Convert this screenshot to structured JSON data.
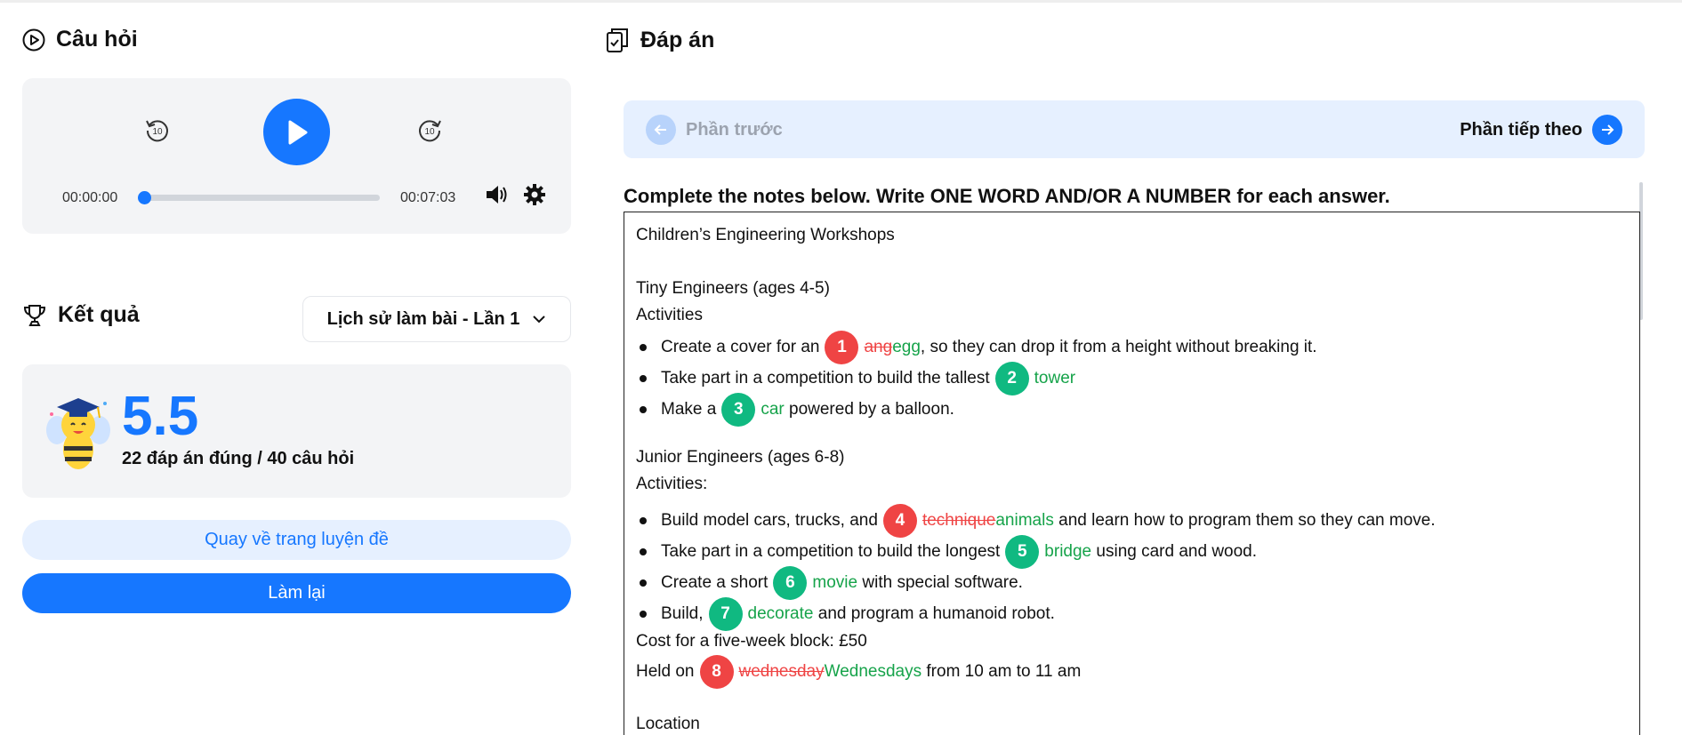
{
  "question_section": {
    "title": "Câu hỏi"
  },
  "player": {
    "current_time": "00:00:00",
    "total_time": "00:07:03",
    "skip_seconds": "10",
    "progress": 0
  },
  "result_section": {
    "title": "Kết quả",
    "history_label": "Lịch sử làm bài - Lần 1",
    "score": "5.5",
    "score_summary": "22 đáp án đúng / 40 câu hỏi",
    "back_button": "Quay về trang luyện đề",
    "retry_button": "Làm lại"
  },
  "answer_section": {
    "title": "Đáp án",
    "prev_label": "Phần trước",
    "next_label": "Phần tiếp theo",
    "instruction": "Complete the notes below. Write ONE WORD AND/OR A NUMBER for each answer."
  },
  "notes": {
    "heading": "Children’s Engineering Workshops",
    "tiny_heading": "Tiny Engineers (ages 4-5)",
    "tiny_activities": "Activities",
    "q1": {
      "before": "Create a cover for an",
      "num": "1",
      "wrong": "ang",
      "correct": "egg",
      "after": ", so they can drop it from a height without breaking it."
    },
    "q2": {
      "before": "Take part in a competition to build the tallest",
      "num": "2",
      "correct": "tower"
    },
    "q3": {
      "before": "Make a",
      "num": "3",
      "correct": "car",
      "after": "powered by a balloon."
    },
    "junior_heading": "Junior Engineers (ages 6-8)",
    "junior_activities": "Activities:",
    "q4": {
      "before": "Build model cars, trucks, and",
      "num": "4",
      "wrong": "technique",
      "correct": "animals",
      "after": "and learn how to program them so they can move."
    },
    "q5": {
      "before": "Take part in a competition to build the longest",
      "num": "5",
      "correct": "bridge",
      "after": "using card and wood."
    },
    "q6": {
      "before": "Create a short",
      "num": "6",
      "correct": "movie",
      "after": "with special software."
    },
    "q7": {
      "before": "Build,",
      "num": "7",
      "correct": "decorate",
      "after": "and program a humanoid robot."
    },
    "cost": "Cost for a five-week block: £50",
    "q8": {
      "before": "Held on",
      "num": "8",
      "wrong": "wednesday",
      "correct": "Wednesdays",
      "after": "from 10 am to 11 am"
    },
    "location": "Location"
  },
  "colors": {
    "accent": "#1677ff",
    "wrong": "#ef4444",
    "correct": "#16a34a",
    "badge_correct": "#10b981"
  },
  "icons": [
    "play-circle-icon",
    "rewind-10-icon",
    "play-icon",
    "forward-10-icon",
    "volume-icon",
    "gear-icon",
    "trophy-icon",
    "chevron-down-icon",
    "bee-mascot-icon",
    "clipboard-check-icon",
    "arrow-left-icon",
    "arrow-right-icon"
  ]
}
